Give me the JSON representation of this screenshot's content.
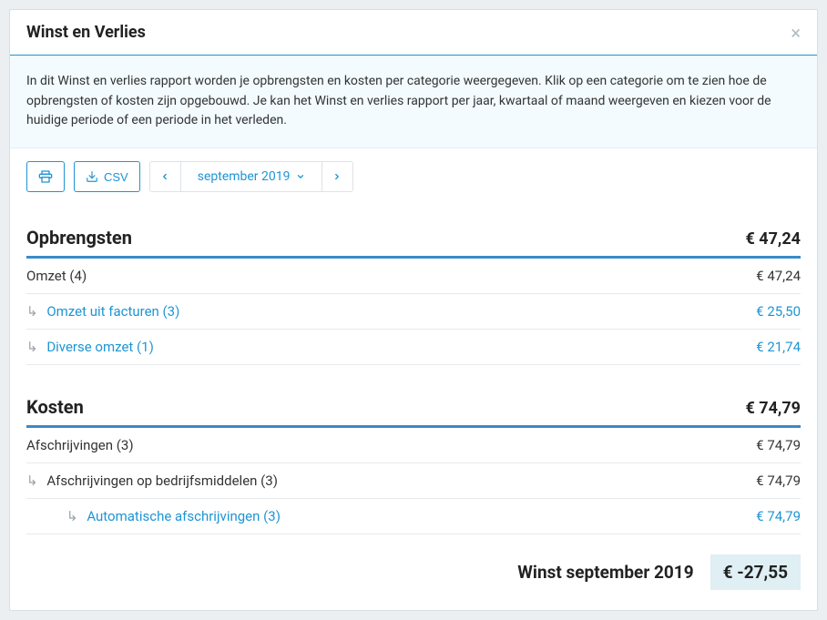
{
  "header": {
    "title": "Winst en Verlies"
  },
  "intro": {
    "text": "In dit Winst en verlies rapport worden je opbrengsten en kosten per categorie weergegeven. Klik op een categorie om te zien hoe de opbrengsten of kosten zijn opgebouwd. Je kan het Winst en verlies rapport per jaar, kwartaal of maand weergeven en kiezen voor de huidige periode of een periode in het verleden."
  },
  "toolbar": {
    "csv_label": "CSV",
    "period_label": "september 2019"
  },
  "opbrengsten": {
    "heading": "Opbrengsten",
    "total": "€ 47,24",
    "rows": [
      {
        "label": "Omzet (4)",
        "amount": "€ 47,24"
      }
    ],
    "subrows": [
      {
        "label": "Omzet uit facturen (3)",
        "amount": "€ 25,50"
      },
      {
        "label": "Diverse omzet (1)",
        "amount": "€ 21,74"
      }
    ]
  },
  "kosten": {
    "heading": "Kosten",
    "total": "€ 74,79",
    "rows": [
      {
        "label": "Afschrijvingen (3)",
        "amount": "€ 74,79"
      }
    ],
    "sub1": {
      "label": "Afschrijvingen op bedrijfsmiddelen (3)",
      "amount": "€ 74,79"
    },
    "sub2": {
      "label": "Automatische afschrijvingen (3)",
      "amount": "€ 74,79"
    }
  },
  "result": {
    "label": "Winst september 2019",
    "amount": "€ -27,55"
  }
}
